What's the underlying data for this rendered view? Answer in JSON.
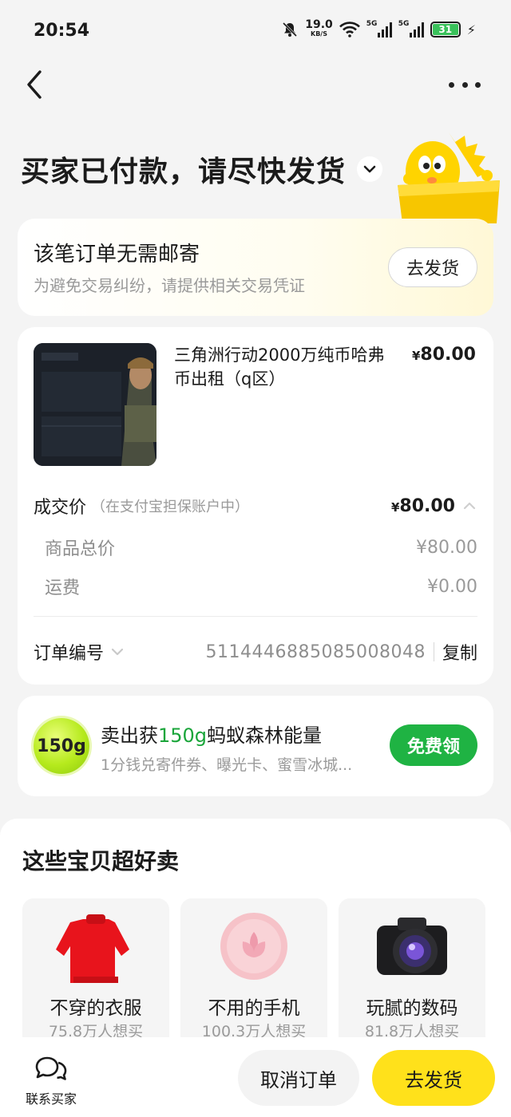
{
  "status_bar": {
    "time": "20:54",
    "net_speed": "19.0",
    "net_unit": "KB/S",
    "sim1_label": "5G",
    "sim2_label": "5G",
    "battery": "31"
  },
  "header": {
    "title": "买家已付款，请尽快发货"
  },
  "shipping_notice": {
    "title": "该笔订单无需邮寄",
    "subtitle": "为避免交易纠纷，请提供相关交易凭证",
    "button": "去发货"
  },
  "order": {
    "product_title": "三角洲行动2000万纯币哈弗币出租（q区）",
    "currency": "¥",
    "product_price": "80.00",
    "deal_label": "成交价",
    "deal_note": "（在支付宝担保账户中）",
    "deal_price": "80.00",
    "goods_total_label": "商品总价",
    "goods_total_value": "¥80.00",
    "shipping_fee_label": "运费",
    "shipping_fee_value": "¥0.00",
    "order_no_label": "订单编号",
    "order_no_value": "5114446885085008048",
    "copy_label": "复制"
  },
  "energy": {
    "badge": "150g",
    "title_prefix": "卖出获",
    "title_highlight": "150g",
    "title_suffix": "蚂蚁森林能量",
    "subtitle": "1分钱兑寄件券、曝光卡、蜜雪冰城...",
    "button": "免费领"
  },
  "sell_section": {
    "heading": "这些宝贝超好卖",
    "items": [
      {
        "label": "不穿的衣服",
        "sub": "75.8万人想买"
      },
      {
        "label": "不用的手机",
        "sub": "100.3万人想买"
      },
      {
        "label": "玩腻的数码",
        "sub": "81.8万人想买"
      }
    ]
  },
  "bottom_bar": {
    "contact_label": "联系买家",
    "cancel_label": "取消订单",
    "ship_label": "去发货"
  },
  "colors": {
    "accent_yellow": "#ffe11b",
    "accent_green": "#1fb343",
    "text_primary": "#1b1b1b",
    "text_muted": "#9a9a9a"
  }
}
